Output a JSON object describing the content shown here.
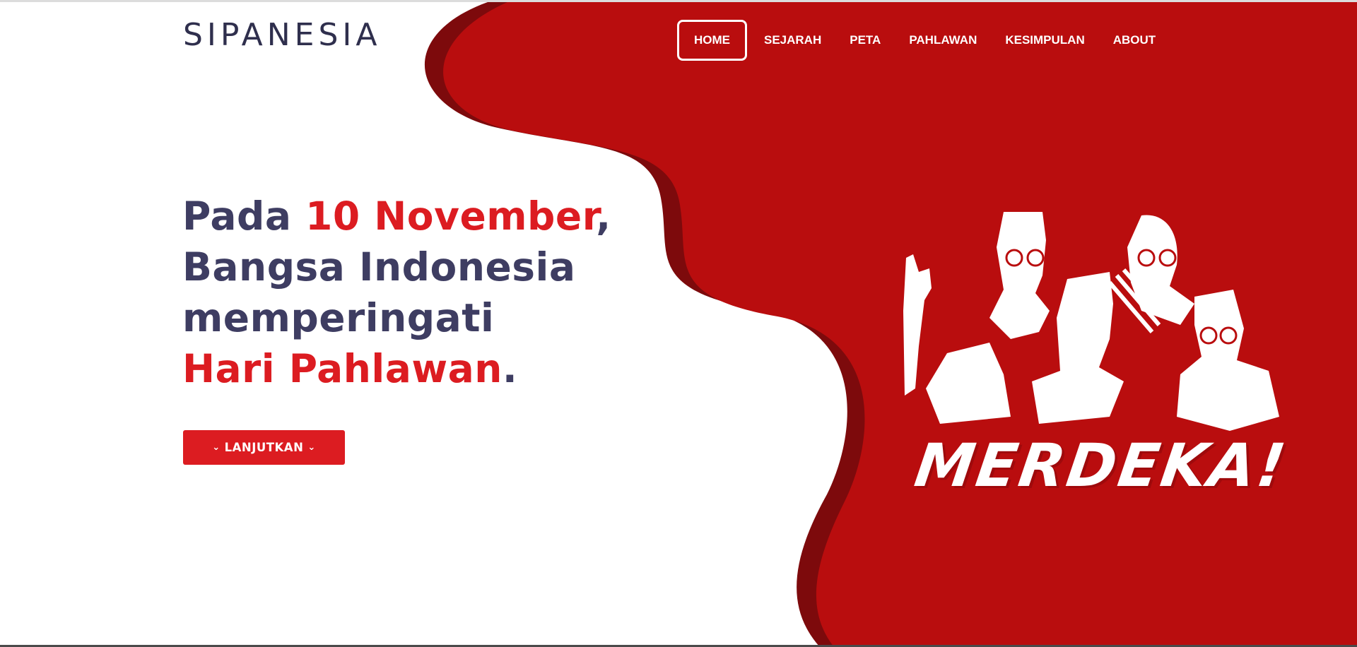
{
  "brand": {
    "logo": "SIPANESIA"
  },
  "nav": {
    "items": [
      {
        "label": "HOME",
        "active": true
      },
      {
        "label": "SEJARAH"
      },
      {
        "label": "PETA"
      },
      {
        "label": "PAHLAWAN"
      },
      {
        "label": "KESIMPULAN"
      },
      {
        "label": "ABOUT"
      }
    ]
  },
  "hero": {
    "line1_a": "Pada ",
    "line1_b": "10 November",
    "line1_c": ",",
    "line2": "Bangsa Indonesia",
    "line3": "memperingati",
    "line4_a": "Hari Pahlawan",
    "line4_b": ".",
    "cta_label": "LANJUTKAN",
    "cta_icon": "chevron-down-icon"
  },
  "illustration": {
    "text": "MERDEKA!"
  },
  "colors": {
    "primary_red": "#dc1c21",
    "wave_red": "#b90d0e",
    "wave_dark": "#7d0a0c",
    "text_dark": "#3e3d62",
    "logo": "#2f2f4d"
  }
}
